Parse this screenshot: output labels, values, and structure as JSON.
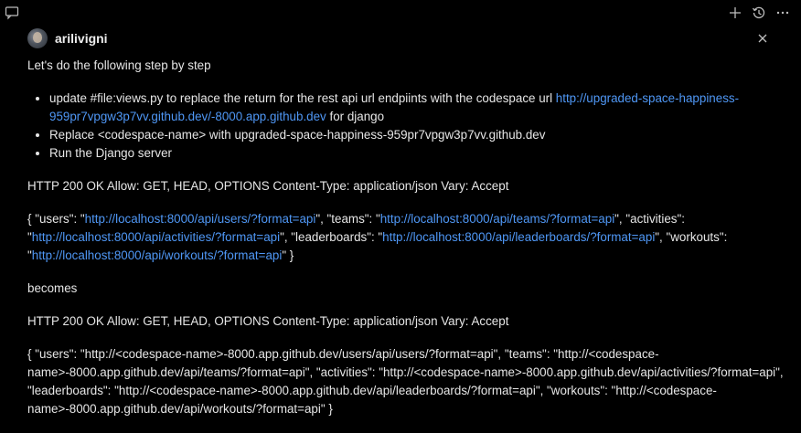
{
  "titlebar": {
    "icons": [
      "chat-window-icon",
      "add-icon",
      "history-icon",
      "more-icon"
    ]
  },
  "message": {
    "username": "arilivigni",
    "intro": "Let's do the following step by step",
    "bullets": {
      "b1_pre": "update #file:views.py to replace the return for the rest api url endpiints with the codespace url ",
      "b1_link": "http://upgraded-space-happiness-959pr7vpgw3p7vv.github.dev/-8000.app.github.dev",
      "b1_post": " for django",
      "b2": "Replace <codespace-name> with upgraded-space-happiness-959pr7vpgw3p7vv.github.dev",
      "b3": "Run the Django server"
    },
    "http_header_1": "HTTP 200 OK Allow: GET, HEAD, OPTIONS Content-Type: application/json Vary: Accept",
    "json1": {
      "p0": "{ \"users\": \"",
      "users_link": "http://localhost:8000/api/users/?format=api",
      "p1": "\", \"teams\": \"",
      "teams_link": "http://localhost:8000/api/teams/?format=api",
      "p2": "\", \"activities\": \"",
      "activities_link": "http://localhost:8000/api/activities/?format=api",
      "p3": "\", \"leaderboards\": \"",
      "leaderboards_link": "http://localhost:8000/api/leaderboards/?format=api",
      "p4": "\", \"workouts\": \"",
      "workouts_link": "http://localhost:8000/api/workouts/?format=api",
      "p5": "\" }"
    },
    "becomes": "becomes",
    "http_header_2": "HTTP 200 OK Allow: GET, HEAD, OPTIONS Content-Type: application/json Vary: Accept",
    "json2": "{ \"users\": \"http://<codespace-name>-8000.app.github.dev/users/api/users/?format=api\", \"teams\": \"http://<codespace-name>-8000.app.github.dev/api/teams/?format=api\", \"activities\": \"http://<codespace-name>-8000.app.github.dev/api/activities/?format=api\", \"leaderboards\": \"http://<codespace-name>-8000.app.github.dev/api/leaderboards/?format=api\", \"workouts\": \"http://<codespace-name>-8000.app.github.dev/api/workouts/?format=api\" }"
  },
  "colors": {
    "background": "#000000",
    "text": "#e6e6e6",
    "link": "#4f97f5",
    "icon": "#bdbdbd"
  }
}
